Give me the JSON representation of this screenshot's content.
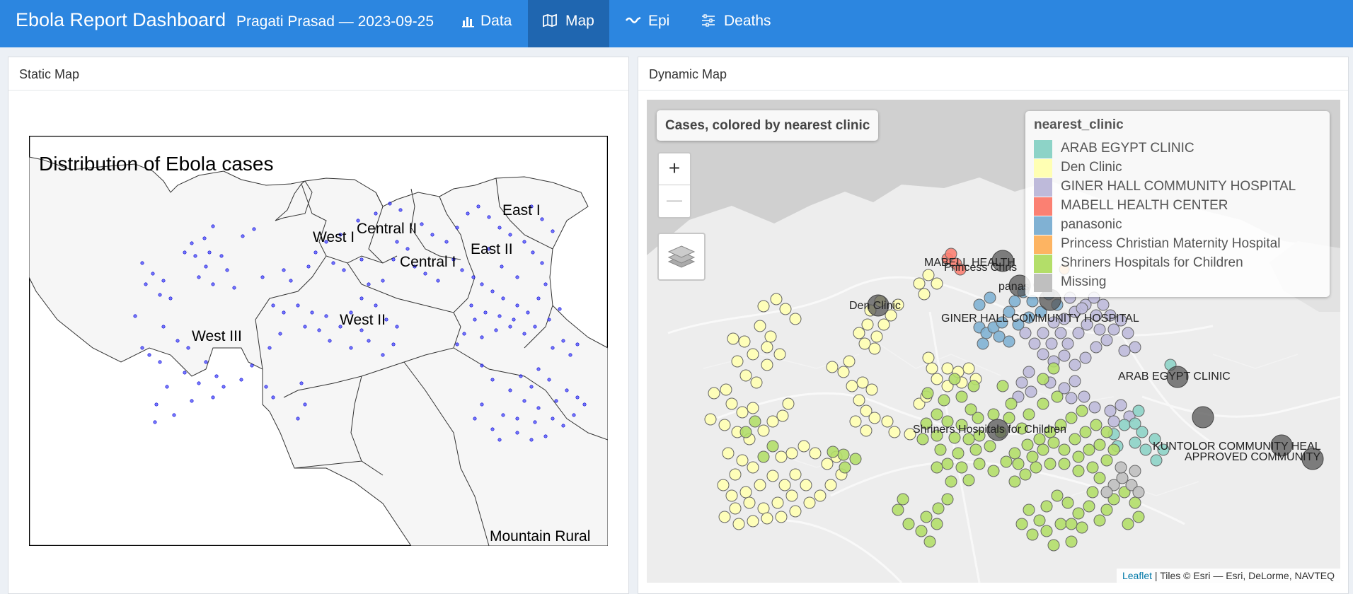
{
  "header": {
    "title": "Ebola Report Dashboard",
    "subtitle": "Pragati Prasad — 2023-09-25",
    "tabs": [
      {
        "label": "Data",
        "icon": "bar-chart-icon"
      },
      {
        "label": "Map",
        "icon": "map-icon",
        "active": true
      },
      {
        "label": "Epi",
        "icon": "line-chart-icon"
      },
      {
        "label": "Deaths",
        "icon": "sliders-icon"
      }
    ],
    "colors": {
      "navbar": "#2c86e0",
      "active_tab": "#1f66b0"
    }
  },
  "static_panel": {
    "title": "Static Map",
    "map_title": "Distribution of Ebola cases",
    "regions": [
      "West I",
      "Central II",
      "Central I",
      "East I",
      "East II",
      "West II",
      "West III",
      "Mountain Rural"
    ],
    "point_color": "#2020ff"
  },
  "dynamic_panel": {
    "title": "Dynamic Map",
    "map_title": "Cases, colored by nearest clinic",
    "zoom_in": "+",
    "zoom_out": "—",
    "legend": {
      "title": "nearest_clinic",
      "items": [
        {
          "label": "ARAB EGYPT CLINIC",
          "color": "#8dd3c7"
        },
        {
          "label": "Den Clinic",
          "color": "#ffffb3"
        },
        {
          "label": "GINER HALL COMMUNITY HOSPITAL",
          "color": "#bebada"
        },
        {
          "label": "MABELL HEALTH CENTER",
          "color": "#fb8072"
        },
        {
          "label": "panasonic",
          "color": "#80b1d3"
        },
        {
          "label": "Princess Christian Maternity Hospital",
          "color": "#fdb462"
        },
        {
          "label": "Shriners Hospitals for Children",
          "color": "#b3de69"
        },
        {
          "label": "Missing",
          "color": "#bfbfbf"
        }
      ]
    },
    "clinic_labels": [
      "MABELL HEALTH",
      "Princess Chris",
      "panas",
      "Den Clinic",
      "GINER HALL COMMUNITY HOSPITAL",
      "ARAB EGYPT CLINIC",
      "Shriners Hospitals for Children",
      "KUNTOLOR COMMUNITY HEAL",
      "APPROVED COMMUNITY"
    ],
    "attribution": {
      "link": "Leaflet",
      "text": "| Tiles © Esri — Esri, DeLorme, NAVTEQ"
    }
  }
}
